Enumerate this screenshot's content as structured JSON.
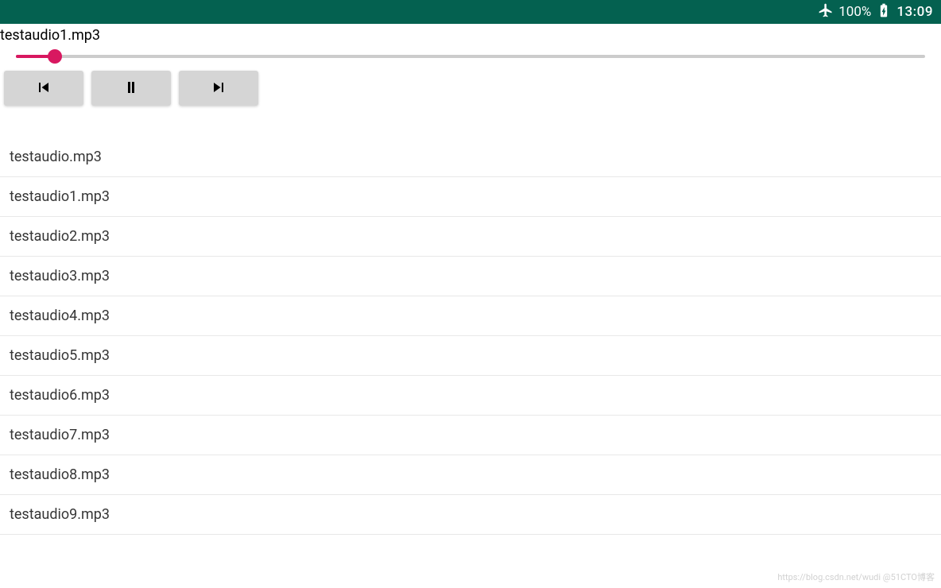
{
  "status_bar": {
    "battery_percent": "100%",
    "time": "13:09"
  },
  "player": {
    "current_track": "testaudio1.mp3",
    "progress_percent": 4.3
  },
  "controls": {
    "previous": "previous",
    "pause": "pause",
    "next": "next"
  },
  "playlist": [
    "testaudio.mp3",
    "testaudio1.mp3",
    "testaudio2.mp3",
    "testaudio3.mp3",
    "testaudio4.mp3",
    "testaudio5.mp3",
    "testaudio6.mp3",
    "testaudio7.mp3",
    "testaudio8.mp3",
    "testaudio9.mp3"
  ],
  "watermark": "https://blog.csdn.net/wudi @51CTO博客"
}
